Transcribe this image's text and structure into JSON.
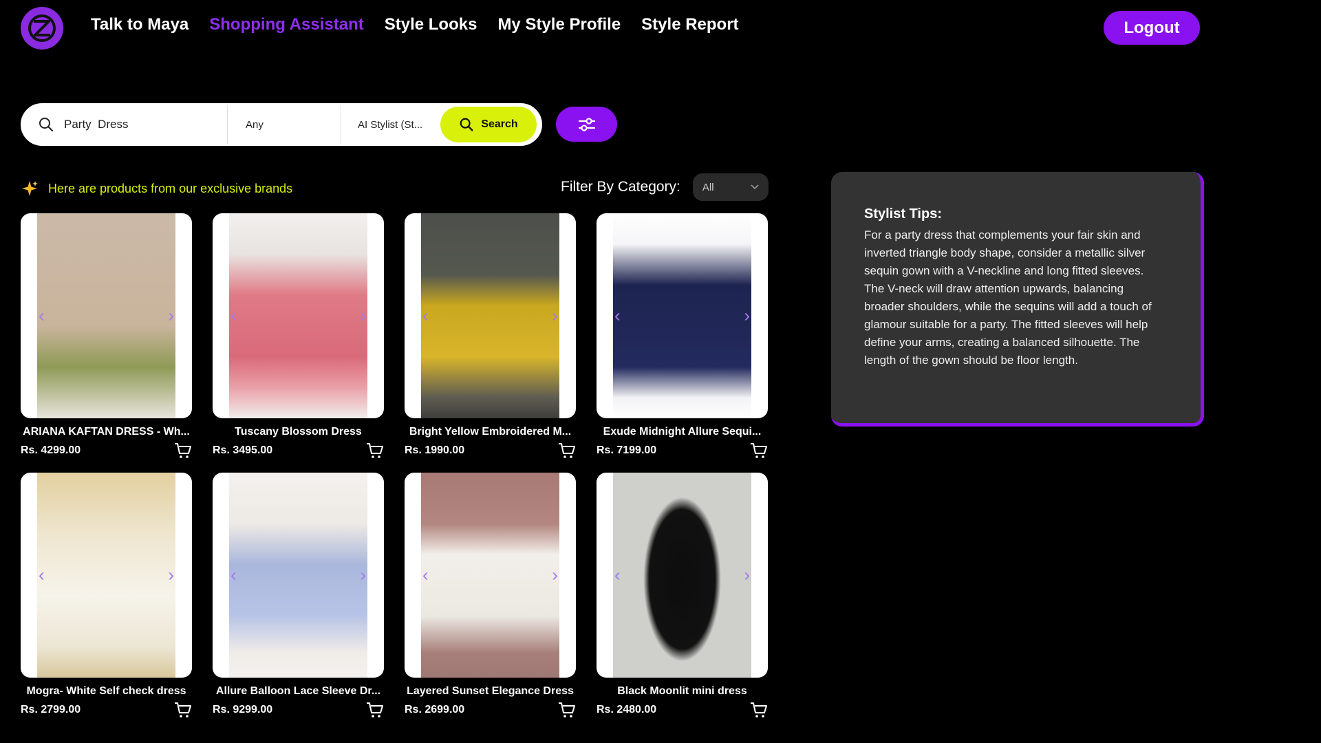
{
  "nav": {
    "items": [
      {
        "label": "Talk to Maya",
        "active": false
      },
      {
        "label": "Shopping Assistant",
        "active": true
      },
      {
        "label": "Style Looks",
        "active": false
      },
      {
        "label": "My Style Profile",
        "active": false
      },
      {
        "label": "Style Report",
        "active": false
      }
    ],
    "logout_label": "Logout"
  },
  "search": {
    "query": "Party  Dress",
    "option_any": "Any",
    "option_stylist": "AI Stylist (St...",
    "button_label": "Search"
  },
  "results": {
    "banner": "Here are products from our exclusive brands",
    "filter_label": "Filter By Category:",
    "filter_value": "All"
  },
  "products": [
    {
      "title": "ARIANA KAFTAN DRESS - Wh...",
      "price": "Rs. 4299.00"
    },
    {
      "title": "Tuscany Blossom Dress",
      "price": "Rs. 3495.00"
    },
    {
      "title": "Bright Yellow Embroidered M...",
      "price": "Rs. 1990.00"
    },
    {
      "title": "Exude Midnight Allure Sequi...",
      "price": "Rs. 7199.00"
    },
    {
      "title": "Mogra- White Self check dress",
      "price": "Rs. 2799.00"
    },
    {
      "title": "Allure Balloon Lace Sleeve Dr...",
      "price": "Rs. 9299.00"
    },
    {
      "title": "Layered Sunset Elegance Dress",
      "price": "Rs. 2699.00"
    },
    {
      "title": "Black Moonlit mini dress",
      "price": "Rs. 2480.00"
    }
  ],
  "tips": {
    "title": "Stylist Tips:",
    "body": "For a party dress that complements your fair skin and inverted triangle body shape, consider a metallic silver sequin gown with a V-neckline and long fitted sleeves. The V-neck will draw attention upwards, balancing broader shoulders, while the sequins will add a touch of glamour suitable for a party. The fitted sleeves will help define your arms, creating a balanced silhouette. The length of the gown should be floor length."
  },
  "colors": {
    "accent": "#8a12f0",
    "highlight": "#d9f00a",
    "background": "#000000"
  }
}
